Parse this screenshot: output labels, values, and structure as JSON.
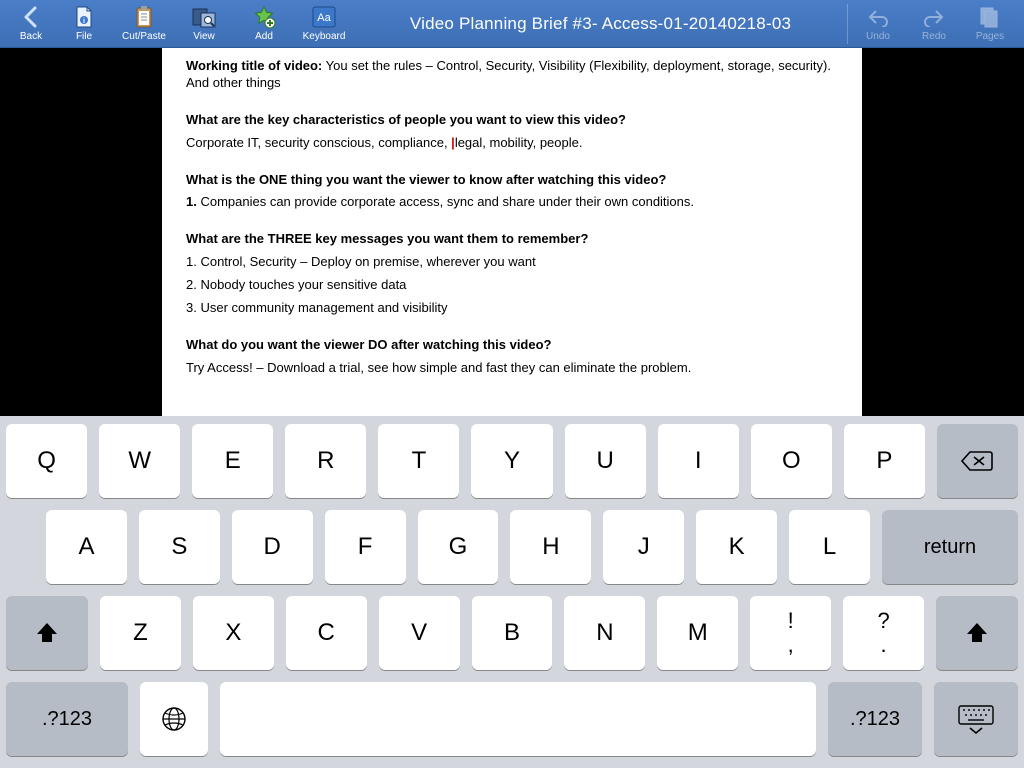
{
  "toolbar": {
    "back": "Back",
    "file": "File",
    "cutpaste": "Cut/Paste",
    "view": "View",
    "add": "Add",
    "keyboard": "Keyboard",
    "undo": "Undo",
    "redo": "Redo",
    "pages": "Pages",
    "title": "Video Planning Brief #3- Access-01-20140218-03"
  },
  "doc": {
    "q1_label": "Working title of video:",
    "q1_text": " You set the rules – Control, Security, Visibility (Flexibility, deployment, storage, security). And other things",
    "q2": "What are the key characteristics of people you want to view this video?",
    "q2_ans_a": "Corporate IT, security conscious, compliance, ",
    "q2_ans_b": "legal, mobility, people.",
    "q3": "What is the ONE thing you want the viewer to know after watching this video?",
    "q3_num": "1.",
    "q3_ans": " Companies can provide corporate access, sync and share under their own conditions.",
    "q4": "What are the THREE key messages you want them to remember?",
    "q4_1": "1. Control, Security – Deploy on premise, wherever you want",
    "q4_2": "2. Nobody touches your sensitive data",
    "q4_3": "3. User community management and visibility",
    "q5": "What do you want the viewer DO after watching this video?",
    "q5_ans": "Try Access! – Download a trial, see how simple and fast they can eliminate the problem."
  },
  "keys": {
    "row1": [
      "Q",
      "W",
      "E",
      "R",
      "T",
      "Y",
      "U",
      "I",
      "O",
      "P"
    ],
    "row2": [
      "A",
      "S",
      "D",
      "F",
      "G",
      "H",
      "J",
      "K",
      "L"
    ],
    "row3": [
      "Z",
      "X",
      "C",
      "V",
      "B",
      "N",
      "M"
    ],
    "punct1_top": "!",
    "punct1_bot": ",",
    "punct2_top": "?",
    "punct2_bot": ".",
    "return": "return",
    "numsym": ".?123",
    "numsym2": ".?123"
  }
}
